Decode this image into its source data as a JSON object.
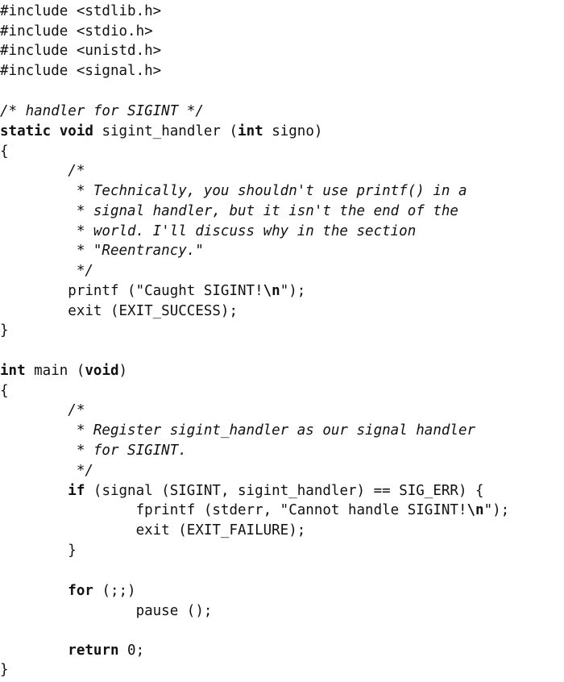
{
  "code": {
    "l1": "#include <stdlib.h>",
    "l2": "#include <stdio.h>",
    "l3": "#include <unistd.h>",
    "l4": "#include <signal.h>",
    "l6": "/* handler for SIGINT */",
    "l7_kw1": "static",
    "l7_kw2": "void",
    "l7_a": " sigint_handler (",
    "l7_kw3": "int",
    "l7_b": " signo)",
    "l8": "{",
    "l9": "        /*",
    "l10": "         * Technically, you shouldn't use printf() in a",
    "l11": "         * signal handler, but it isn't the end of the",
    "l12": "         * world. I'll discuss why in the section",
    "l13": "         * \"Reentrancy.\"",
    "l14": "         */",
    "l15_a": "        printf (\"Caught SIGINT!",
    "l15_esc": "\\n",
    "l15_b": "\");",
    "l16": "        exit (EXIT_SUCCESS);",
    "l17": "}",
    "l19_kw1": "int",
    "l19_a": " main (",
    "l19_kw2": "void",
    "l19_b": ")",
    "l20": "{",
    "l21": "        /*",
    "l22": "         * Register sigint_handler as our signal handler",
    "l23": "         * for SIGINT.",
    "l24": "         */",
    "l25_indent": "        ",
    "l25_kw": "if",
    "l25_a": " (signal (SIGINT, sigint_handler) == SIG_ERR) {",
    "l26_a": "                fprintf (stderr, \"Cannot handle SIGINT!",
    "l26_esc": "\\n",
    "l26_b": "\");",
    "l27": "                exit (EXIT_FAILURE);",
    "l28": "        }",
    "l30_indent": "        ",
    "l30_kw": "for",
    "l30_a": " (;;)",
    "l31": "                pause ();",
    "l33_indent": "        ",
    "l33_kw": "return",
    "l33_a": " 0;",
    "l34": "}"
  }
}
